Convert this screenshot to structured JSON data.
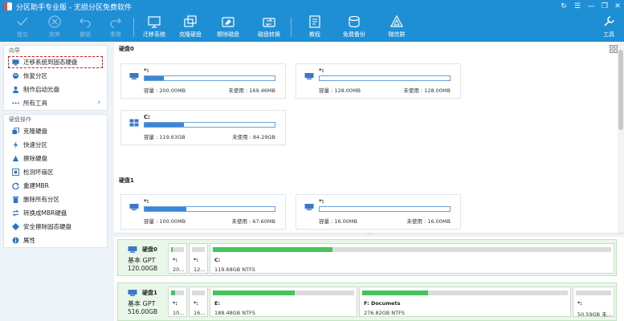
{
  "app": {
    "title": "分区助手专业版 - 无损分区免费软件"
  },
  "window_controls": [
    {
      "name": "refresh-button",
      "glyph": "↻"
    },
    {
      "name": "menu-button",
      "glyph": "☰"
    },
    {
      "name": "minimize-button",
      "glyph": "—"
    },
    {
      "name": "restore-button",
      "glyph": "❐"
    },
    {
      "name": "close-button",
      "glyph": "✕"
    }
  ],
  "toolbar": {
    "commit": "提交",
    "discard": "放弃",
    "undo": "撤销",
    "redo": "重做",
    "migrate_os": "迁移系统",
    "clone_disk": "克隆硬盘",
    "wipe_disk": "擦除磁盘",
    "convert_disk": "磁盘转换",
    "tutorial": "教程",
    "free_backup": "免费备份",
    "wechat": "微信群",
    "tools": "工具"
  },
  "sidebar": {
    "wizard_title": "向导",
    "wizard_items": [
      {
        "label": "迁移系统到固态硬盘",
        "icon": "migrate-icon"
      },
      {
        "label": "恢复分区",
        "icon": "recover-icon"
      },
      {
        "label": "制作启动光盘",
        "icon": "bootable-disc-icon"
      },
      {
        "label": "所有工具",
        "icon": "all-tools-icon"
      }
    ],
    "disk_ops_title": "硬盘操作",
    "disk_ops_items": [
      {
        "label": "克隆硬盘",
        "icon": "clone-icon"
      },
      {
        "label": "快速分区",
        "icon": "quick-partition-icon"
      },
      {
        "label": "擦除硬盘",
        "icon": "wipe-icon"
      },
      {
        "label": "检测坏扇区",
        "icon": "bad-sector-icon"
      },
      {
        "label": "重建MBR",
        "icon": "rebuild-mbr-icon"
      },
      {
        "label": "删除所有分区",
        "icon": "delete-partitions-icon"
      },
      {
        "label": "转换成MBR硬盘",
        "icon": "convert-mbr-icon"
      },
      {
        "label": "安全擦除固态硬盘",
        "icon": "secure-erase-icon"
      },
      {
        "label": "属性",
        "icon": "properties-icon"
      }
    ]
  },
  "partition_view": {
    "disk0_header": "硬盘0",
    "disk1_header": "硬盘1",
    "cap_label": "容量",
    "free_label": "未使用",
    "disk0_cards": [
      {
        "name": "*:",
        "capacity": "200.00MB",
        "free": "169.46MB",
        "used_fraction": 0.15,
        "os": "drive"
      },
      {
        "name": "*:",
        "capacity": "128.00MB",
        "free": "128.00MB",
        "used_fraction": 0.0,
        "os": "drive"
      },
      {
        "name": "C:",
        "capacity": "119.63GB",
        "free": "84.29GB",
        "used_fraction": 0.3,
        "os": "windows"
      }
    ],
    "disk1_cards": [
      {
        "name": "*:",
        "capacity": "100.00MB",
        "free": "67.60MB",
        "used_fraction": 0.32,
        "os": "drive"
      },
      {
        "name": "*:",
        "capacity": "16.00MB",
        "free": "16.00MB",
        "used_fraction": 0.0,
        "os": "drive"
      }
    ]
  },
  "disk_map": [
    {
      "name": "硬盘0",
      "type": "基本 GPT",
      "size": "120.00GB",
      "partitions": [
        {
          "name": "*:",
          "detail": "20...",
          "used_fraction": 0.15
        },
        {
          "name": "*:",
          "detail": "12...",
          "used_fraction": 0.0
        },
        {
          "name": "C:",
          "detail": "119.68GB NTFS",
          "used_fraction": 0.3
        }
      ]
    },
    {
      "name": "硬盘1",
      "type": "基本 GPT",
      "size": "516.00GB",
      "partitions": [
        {
          "name": "*:",
          "detail": "10...",
          "used_fraction": 0.32
        },
        {
          "name": "*:",
          "detail": "16...",
          "used_fraction": 0.0
        },
        {
          "name": "E:",
          "detail": "188.48GB NTFS",
          "used_fraction": 0.58
        },
        {
          "name": "F: Documets",
          "detail": "276.82GB NTFS",
          "used_fraction": 0.32
        },
        {
          "name": "*:",
          "detail": "50.59GB 未...",
          "used_fraction": 0.0
        }
      ]
    }
  ],
  "colors": {
    "toolbar": "#1f8fd5",
    "used": "#3a86d8",
    "map_used": "#47c35b",
    "selection": "#d42020"
  }
}
